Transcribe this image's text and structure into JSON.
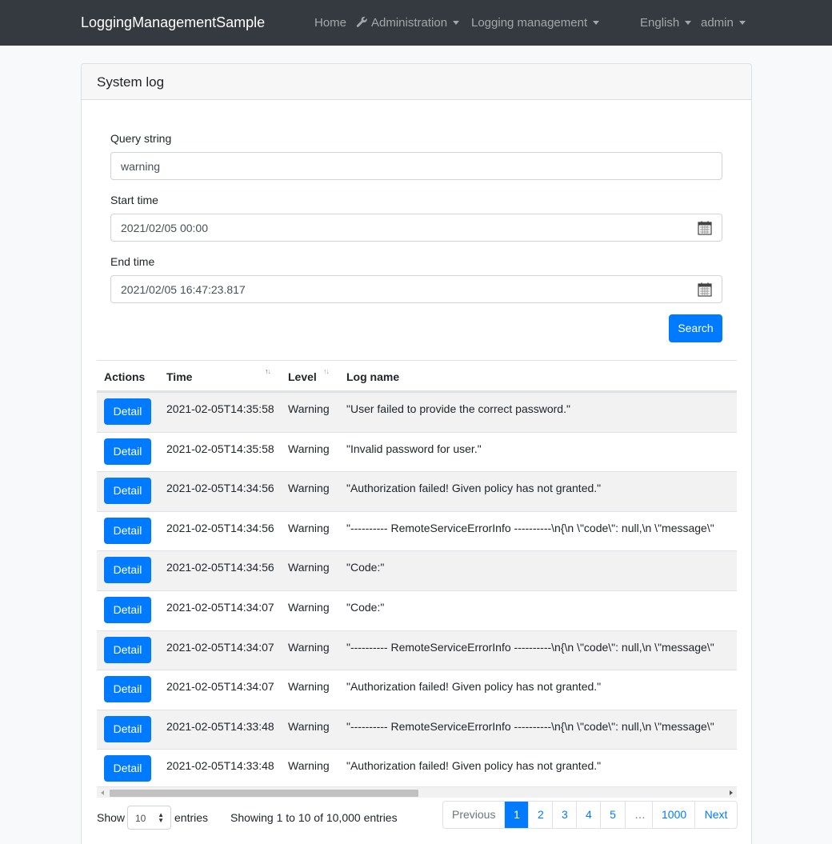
{
  "navbar": {
    "brand": "LoggingManagementSample",
    "home": "Home",
    "administration": "Administration",
    "logging_management": "Logging management",
    "language": "English",
    "user": "admin"
  },
  "card": {
    "title": "System log"
  },
  "form": {
    "query_label": "Query string",
    "query_value": "warning",
    "start_label": "Start time",
    "start_value": "2021/02/05 00:00",
    "end_label": "End time",
    "end_value": "2021/02/05 16:47:23.817",
    "search_button": "Search"
  },
  "table": {
    "columns": [
      "Actions",
      "Time",
      "Level",
      "Log name"
    ],
    "detail_label": "Detail",
    "rows": [
      {
        "time": "2021-02-05T14:35:58",
        "level": "Warning",
        "log": "\"User failed to provide the correct password.\""
      },
      {
        "time": "2021-02-05T14:35:58",
        "level": "Warning",
        "log": "\"Invalid password for user.\""
      },
      {
        "time": "2021-02-05T14:34:56",
        "level": "Warning",
        "log": "\"Authorization failed! Given policy has not granted.\""
      },
      {
        "time": "2021-02-05T14:34:56",
        "level": "Warning",
        "log": "\"---------- RemoteServiceErrorInfo ----------\\n{\\n \\\"code\\\": null,\\n \\\"message\\\""
      },
      {
        "time": "2021-02-05T14:34:56",
        "level": "Warning",
        "log": "\"Code:\""
      },
      {
        "time": "2021-02-05T14:34:07",
        "level": "Warning",
        "log": "\"Code:\""
      },
      {
        "time": "2021-02-05T14:34:07",
        "level": "Warning",
        "log": "\"---------- RemoteServiceErrorInfo ----------\\n{\\n \\\"code\\\": null,\\n \\\"message\\\""
      },
      {
        "time": "2021-02-05T14:34:07",
        "level": "Warning",
        "log": "\"Authorization failed! Given policy has not granted.\""
      },
      {
        "time": "2021-02-05T14:33:48",
        "level": "Warning",
        "log": "\"---------- RemoteServiceErrorInfo ----------\\n{\\n \\\"code\\\": null,\\n \\\"message\\\""
      },
      {
        "time": "2021-02-05T14:33:48",
        "level": "Warning",
        "log": "\"Authorization failed! Given policy has not granted.\""
      }
    ]
  },
  "footer": {
    "show_label": "Show",
    "page_size": "10",
    "entries_label": "entries",
    "info": "Showing 1 to 10 of 10,000 entries",
    "pagination": [
      "Previous",
      "1",
      "2",
      "3",
      "4",
      "5",
      "…",
      "1000",
      "Next"
    ],
    "active_page": "1"
  },
  "colors": {
    "navbar": "#343a40",
    "primary": "#007bff"
  }
}
